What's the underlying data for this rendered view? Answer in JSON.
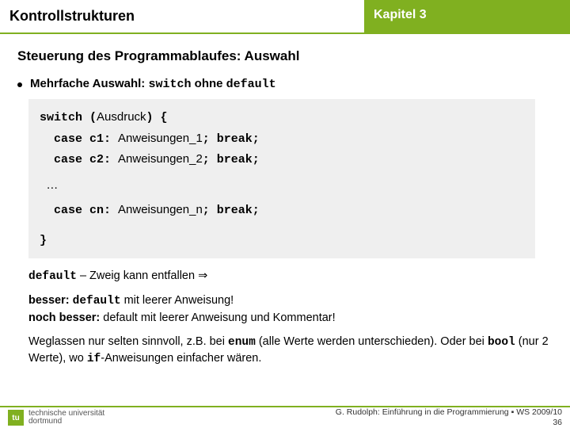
{
  "header": {
    "left": "Kontrollstrukturen",
    "right": "Kapitel 3"
  },
  "subtitle": "Steuerung des Programmablaufes: Auswahl",
  "bullet": {
    "prefix": "Mehrfache Auswahl: ",
    "code1": "switch",
    "mid": " ohne ",
    "code2": "default"
  },
  "code": {
    "l1a": "switch (",
    "l1b": "Ausdruck",
    "l1c": ") {",
    "l2a": "  case c1: ",
    "l2b": "Anweisungen_1",
    "l2c": "; break;",
    "l3a": "  case c2: ",
    "l3b": "Anweisungen_2",
    "l3c": "; break;",
    "dots": "  …",
    "l4a": "  case cn: ",
    "l4b": "Anweisungen_n",
    "l4c": "; break;",
    "end": "}"
  },
  "p1": {
    "a": "default",
    "b": " – Zweig kann entfallen ⇒"
  },
  "p2": {
    "a": "besser: ",
    "b": "default",
    "c": " mit leerer Anweisung!",
    "d": "noch besser:",
    "e": " default mit leerer Anweisung und Kommentar!"
  },
  "p3": {
    "a": "Weglassen nur selten sinnvoll, z.B. bei ",
    "b": "enum",
    "c": " (alle Werte werden unterschieden). Oder bei ",
    "d": "bool",
    "e": " (nur 2 Werte), wo ",
    "f": "if",
    "g": "-Anweisungen einfacher wären."
  },
  "logo": {
    "mark": "tu",
    "line1": "technische universität",
    "line2": "dortmund"
  },
  "footer": {
    "line1": "G. Rudolph: Einführung in die Programmierung ▪ WS 2009/10",
    "line2": "36"
  }
}
